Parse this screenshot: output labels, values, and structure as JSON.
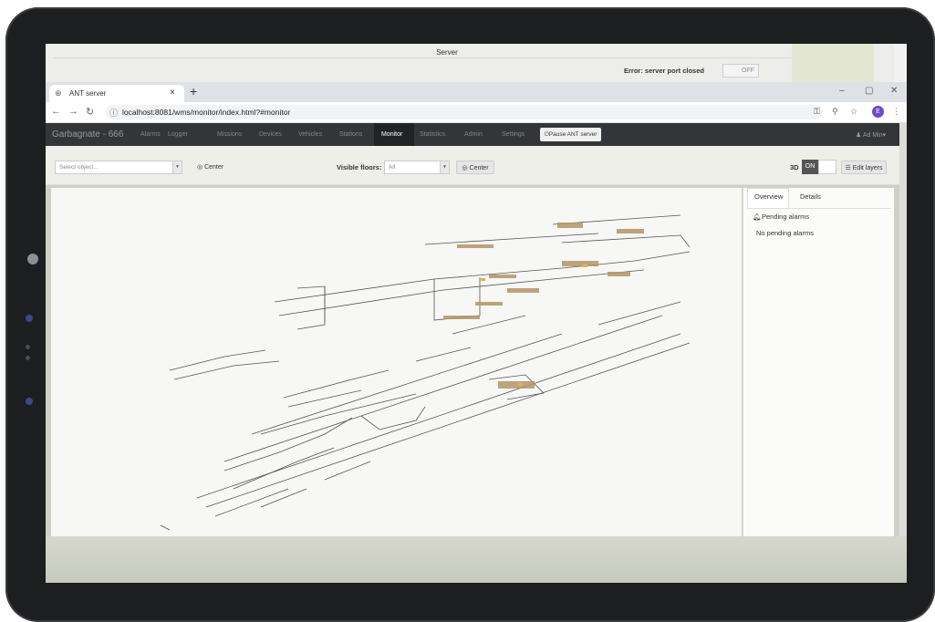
{
  "server_window": {
    "title": "Server",
    "error_text": "Error: server port closed",
    "toggle_label": "OFF"
  },
  "browser": {
    "tab_title": "ANT server",
    "tab_close": "×",
    "new_tab": "+",
    "url": "localhost:8081/wms/monitor/index.html?#monitor",
    "avatar_letter": "E",
    "window_controls": [
      "–",
      "▢",
      "✕"
    ]
  },
  "navbar": {
    "brand": "Garbagnate - 666",
    "items": [
      "Alarms",
      "Logger",
      "Missions",
      "Devices",
      "Vehicles",
      "Stations",
      "Monitor",
      "Statistics",
      "Admin",
      "Settings"
    ],
    "active": "Monitor",
    "pause_button": "Pause ANT server",
    "user": "Ad Min"
  },
  "toolbar": {
    "select_placeholder": "Select object...",
    "center_1": "Center",
    "visible_floors_label": "Visible floors:",
    "floors_value": "All",
    "center_2": "Center",
    "view_3d_label": "3D",
    "toggle_on": "ON",
    "edit_layers": "Edit layers"
  },
  "side_panel": {
    "tabs": [
      "Overview",
      "Details"
    ],
    "selected_tab": "Overview",
    "pending_header": "Pending alarms",
    "pending_text": "No pending alarms"
  },
  "colors": {
    "navbar_bg": "#333539",
    "bezel": "#1d1e20",
    "avatar": "#6c4ac9",
    "map_bg": "#f7f7f5"
  }
}
